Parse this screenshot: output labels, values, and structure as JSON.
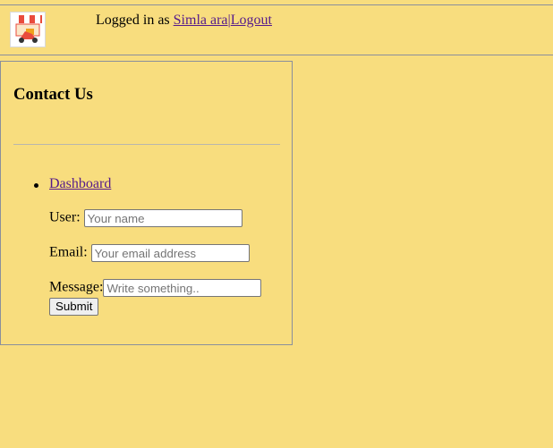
{
  "header": {
    "logo_icon": "delivery-scooter-logo-icon",
    "logged_in_prefix": "Logged in as ",
    "user_name": "Simla ara",
    "separator": "|",
    "logout_label": "Logout"
  },
  "contact": {
    "title": "Contact Us",
    "nav_items": [
      {
        "label": "Dashboard"
      }
    ],
    "form": {
      "user_label": "User:",
      "user_placeholder": "Your name",
      "user_value": "",
      "email_label": "Email:",
      "email_placeholder": "Your email address",
      "email_value": "",
      "message_label": "Message:",
      "message_placeholder": "Write something..",
      "message_value": "",
      "submit_label": "Submit"
    }
  },
  "colors": {
    "background": "#f8dd7e",
    "border": "#8a8f9c",
    "link": "#551a8b"
  }
}
